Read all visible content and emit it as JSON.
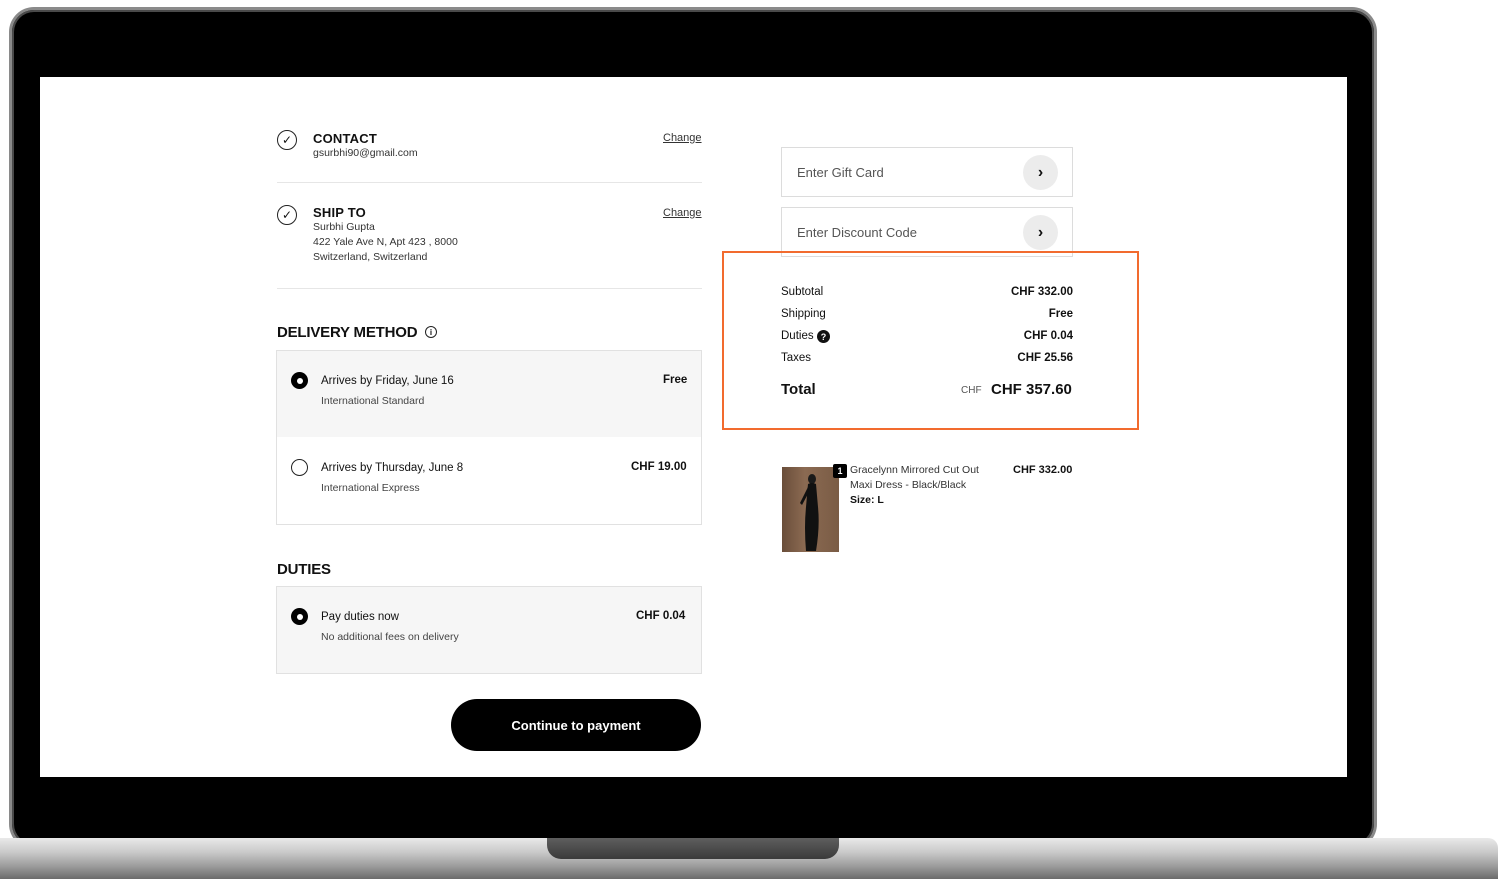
{
  "contact": {
    "title": "CONTACT",
    "email": "gsurbhi90@gmail.com",
    "change_label": "Change"
  },
  "ship_to": {
    "title": "SHIP TO",
    "name": "Surbhi Gupta",
    "address_line": "422 Yale Ave N, Apt 423 , 8000",
    "country_line": "Switzerland, Switzerland",
    "change_label": "Change"
  },
  "delivery": {
    "heading": "DELIVERY METHOD",
    "info_icon": "info-icon",
    "options": [
      {
        "title": "Arrives by Friday, June 16",
        "subtitle": "International Standard",
        "price": "Free",
        "selected": true
      },
      {
        "title": "Arrives by Thursday, June 8",
        "subtitle": "International Express",
        "price": "CHF 19.00",
        "selected": false
      }
    ]
  },
  "duties": {
    "heading": "DUTIES",
    "option": {
      "title": "Pay duties now",
      "subtitle": "No additional fees on delivery",
      "price": "CHF 0.04",
      "selected": true
    }
  },
  "continue_label": "Continue to payment",
  "gift_card": {
    "placeholder": "Enter Gift Card"
  },
  "discount": {
    "placeholder": "Enter Discount Code"
  },
  "summary": {
    "subtotal_label": "Subtotal",
    "subtotal": "CHF 332.00",
    "shipping_label": "Shipping",
    "shipping": "Free",
    "duties_label": "Duties",
    "duties": "CHF 0.04",
    "taxes_label": "Taxes",
    "taxes": "CHF 25.56",
    "total_label": "Total",
    "total_currency": "CHF",
    "total": "CHF 357.60",
    "highlight_color": "#f26b2e"
  },
  "product": {
    "qty": "1",
    "name_line1": "Gracelynn Mirrored Cut Out",
    "name_line2": "Maxi Dress - Black/Black",
    "size": "Size: L",
    "price": "CHF 332.00"
  }
}
